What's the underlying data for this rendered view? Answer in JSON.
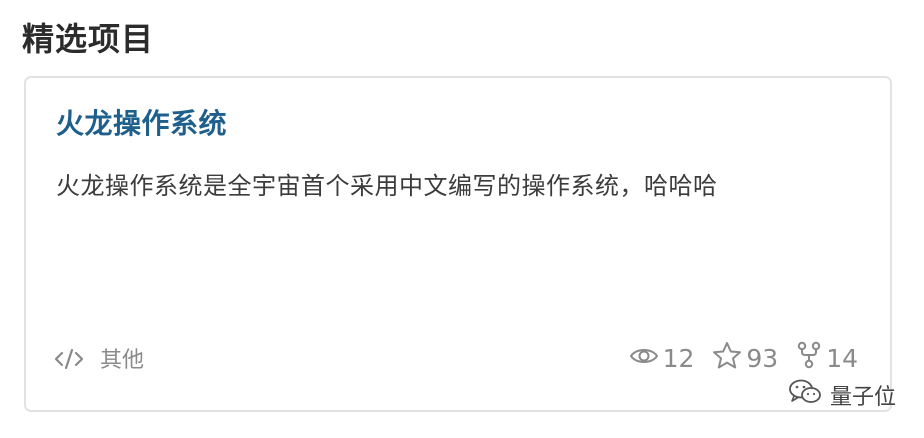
{
  "section": {
    "title": "精选项目"
  },
  "project": {
    "title": "火龙操作系统",
    "description": "火龙操作系统是全宇宙首个采用中文编写的操作系统，哈哈哈",
    "language": {
      "icon": "code-icon",
      "label": "其他"
    },
    "stats": {
      "views": "12",
      "stars": "93",
      "forks": "14"
    }
  },
  "watermark": {
    "text": "量子位",
    "icon": "wechat-icon"
  },
  "colors": {
    "title_link": "#1f5f8b",
    "card_border": "#e2e2e2",
    "muted": "#8a8a8a"
  }
}
